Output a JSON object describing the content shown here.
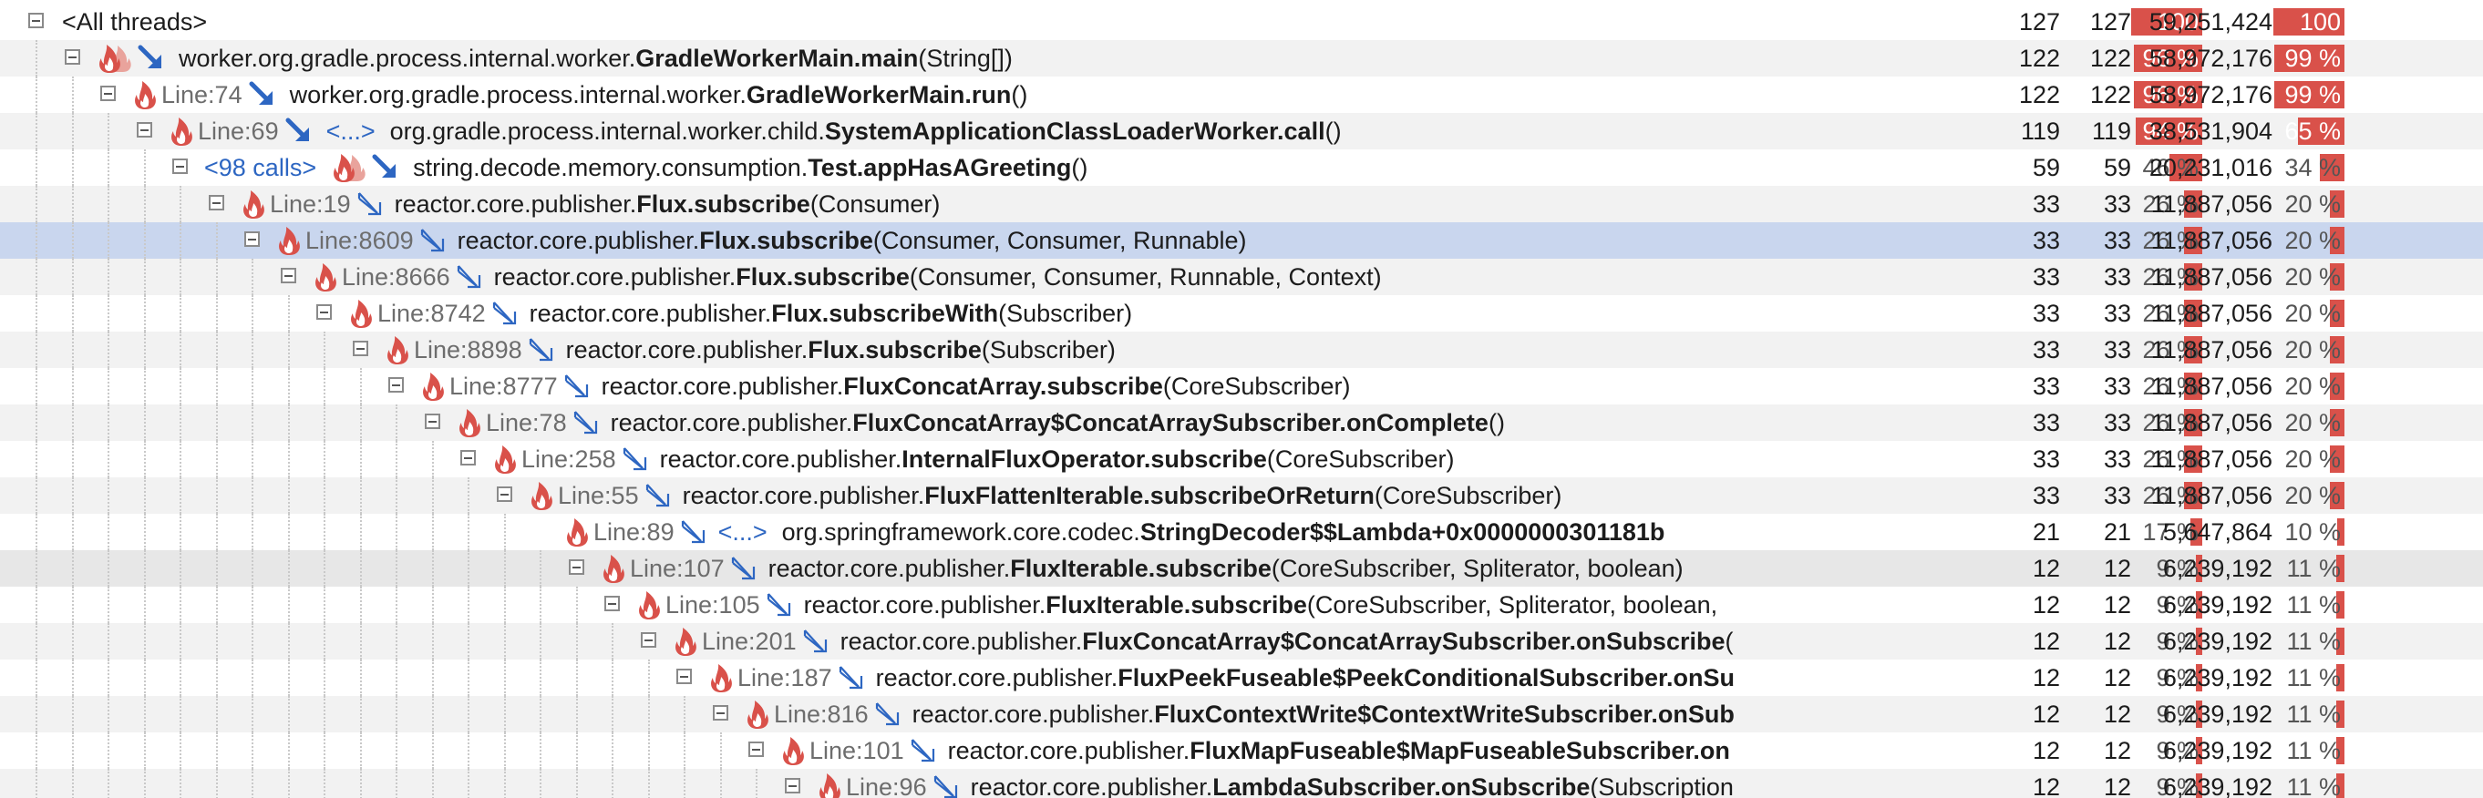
{
  "colors": {
    "accent_red": "#d9514a",
    "selection": "#c9d6ee",
    "call_blue": "#2d66c2",
    "line_gray": "#6d6d6d"
  },
  "icons": [
    "flame-icon",
    "hot-spot-arrow-icon",
    "call-arrow-icon",
    "collapse-icon"
  ],
  "tree": {
    "root": {
      "label": "<All threads>",
      "time_count": "127",
      "invocations": "127",
      "time_pct": "100 %",
      "time_pct_value": 100,
      "bytes": "59,251,424",
      "bytes_pct": "100 %",
      "bytes_pct_value": 100
    },
    "rows": [
      {
        "line": "",
        "calls": "",
        "dots": "",
        "method_prefix": "worker.org.gradle.process.internal.worker.",
        "method_bold": "GradleWorkerMain.main",
        "params": "(String[])",
        "time_count": "122",
        "invocations": "122",
        "time_pct": "96 %",
        "time_pct_value": 96,
        "bytes": "58,972,176",
        "bytes_pct": "99 %",
        "bytes_pct_value": 99
      },
      {
        "line": "Line:74",
        "calls": "",
        "dots": "",
        "method_prefix": "worker.org.gradle.process.internal.worker.",
        "method_bold": "GradleWorkerMain.run",
        "params": "()",
        "time_count": "122",
        "invocations": "122",
        "time_pct": "96 %",
        "time_pct_value": 96,
        "bytes": "58,972,176",
        "bytes_pct": "99 %",
        "bytes_pct_value": 99
      },
      {
        "line": "Line:69",
        "calls": "",
        "dots": "<...>",
        "method_prefix": "org.gradle.process.internal.worker.child.",
        "method_bold": "SystemApplicationClassLoaderWorker.call",
        "params": "()",
        "time_count": "119",
        "invocations": "119",
        "time_pct": "94 %",
        "time_pct_value": 94,
        "bytes": "38,531,904",
        "bytes_pct": "65 %",
        "bytes_pct_value": 65
      },
      {
        "line": "",
        "calls": "<98 calls>",
        "dots": "",
        "method_prefix": "string.decode.memory.consumption.",
        "method_bold": "Test.appHasAGreeting",
        "params": "()",
        "time_count": "59",
        "invocations": "59",
        "time_pct": "46 %",
        "time_pct_value": 46,
        "bytes": "20,231,016",
        "bytes_pct": "34 %",
        "bytes_pct_value": 34
      },
      {
        "line": "Line:19",
        "calls": "",
        "dots": "",
        "method_prefix": "reactor.core.publisher.",
        "method_bold": "Flux.subscribe",
        "params": "(Consumer)",
        "time_count": "33",
        "invocations": "33",
        "time_pct": "26 %",
        "time_pct_value": 26,
        "bytes": "11,887,056",
        "bytes_pct": "20 %",
        "bytes_pct_value": 20
      },
      {
        "line": "Line:8609",
        "calls": "",
        "dots": "",
        "method_prefix": "reactor.core.publisher.",
        "method_bold": "Flux.subscribe",
        "params": "(Consumer, Consumer, Runnable)",
        "time_count": "33",
        "invocations": "33",
        "time_pct": "26 %",
        "time_pct_value": 26,
        "bytes": "11,887,056",
        "bytes_pct": "20 %",
        "bytes_pct_value": 20
      },
      {
        "line": "Line:8666",
        "calls": "",
        "dots": "",
        "method_prefix": "reactor.core.publisher.",
        "method_bold": "Flux.subscribe",
        "params": "(Consumer, Consumer, Runnable, Context)",
        "time_count": "33",
        "invocations": "33",
        "time_pct": "26 %",
        "time_pct_value": 26,
        "bytes": "11,887,056",
        "bytes_pct": "20 %",
        "bytes_pct_value": 20
      },
      {
        "line": "Line:8742",
        "calls": "",
        "dots": "",
        "method_prefix": "reactor.core.publisher.",
        "method_bold": "Flux.subscribeWith",
        "params": "(Subscriber)",
        "time_count": "33",
        "invocations": "33",
        "time_pct": "26 %",
        "time_pct_value": 26,
        "bytes": "11,887,056",
        "bytes_pct": "20 %",
        "bytes_pct_value": 20
      },
      {
        "line": "Line:8898",
        "calls": "",
        "dots": "",
        "method_prefix": "reactor.core.publisher.",
        "method_bold": "Flux.subscribe",
        "params": "(Subscriber)",
        "time_count": "33",
        "invocations": "33",
        "time_pct": "26 %",
        "time_pct_value": 26,
        "bytes": "11,887,056",
        "bytes_pct": "20 %",
        "bytes_pct_value": 20
      },
      {
        "line": "Line:8777",
        "calls": "",
        "dots": "",
        "method_prefix": "reactor.core.publisher.",
        "method_bold": "FluxConcatArray.subscribe",
        "params": "(CoreSubscriber)",
        "time_count": "33",
        "invocations": "33",
        "time_pct": "26 %",
        "time_pct_value": 26,
        "bytes": "11,887,056",
        "bytes_pct": "20 %",
        "bytes_pct_value": 20
      },
      {
        "line": "Line:78",
        "calls": "",
        "dots": "",
        "method_prefix": "reactor.core.publisher.",
        "method_bold": "FluxConcatArray$ConcatArraySubscriber.onComplete",
        "params": "()",
        "time_count": "33",
        "invocations": "33",
        "time_pct": "26 %",
        "time_pct_value": 26,
        "bytes": "11,887,056",
        "bytes_pct": "20 %",
        "bytes_pct_value": 20
      },
      {
        "line": "Line:258",
        "calls": "",
        "dots": "",
        "method_prefix": "reactor.core.publisher.",
        "method_bold": "InternalFluxOperator.subscribe",
        "params": "(CoreSubscriber)",
        "time_count": "33",
        "invocations": "33",
        "time_pct": "26 %",
        "time_pct_value": 26,
        "bytes": "11,887,056",
        "bytes_pct": "20 %",
        "bytes_pct_value": 20
      },
      {
        "line": "Line:55",
        "calls": "",
        "dots": "",
        "method_prefix": "reactor.core.publisher.",
        "method_bold": "FluxFlattenIterable.subscribeOrReturn",
        "params": "(CoreSubscriber)",
        "time_count": "33",
        "invocations": "33",
        "time_pct": "26 %",
        "time_pct_value": 26,
        "bytes": "11,887,056",
        "bytes_pct": "20 %",
        "bytes_pct_value": 20
      },
      {
        "line": "Line:89",
        "calls": "",
        "dots": "<...>",
        "method_prefix": "org.springframework.core.codec.",
        "method_bold": "StringDecoder$$Lambda+0x0000000301181b",
        "params": "",
        "time_count": "21",
        "invocations": "21",
        "time_pct": "17 %",
        "time_pct_value": 17,
        "bytes": "5,647,864",
        "bytes_pct": "10 %",
        "bytes_pct_value": 10
      },
      {
        "line": "Line:107",
        "calls": "",
        "dots": "",
        "method_prefix": "reactor.core.publisher.",
        "method_bold": "FluxIterable.subscribe",
        "params": "(CoreSubscriber, Spliterator, boolean)",
        "time_count": "12",
        "invocations": "12",
        "time_pct": "9 %",
        "time_pct_value": 9,
        "bytes": "6,239,192",
        "bytes_pct": "11 %",
        "bytes_pct_value": 11
      },
      {
        "line": "Line:105",
        "calls": "",
        "dots": "",
        "method_prefix": "reactor.core.publisher.",
        "method_bold": "FluxIterable.subscribe",
        "params": "(CoreSubscriber, Spliterator, boolean,",
        "time_count": "12",
        "invocations": "12",
        "time_pct": "9 %",
        "time_pct_value": 9,
        "bytes": "6,239,192",
        "bytes_pct": "11 %",
        "bytes_pct_value": 11
      },
      {
        "line": "Line:201",
        "calls": "",
        "dots": "",
        "method_prefix": "reactor.core.publisher.",
        "method_bold": "FluxConcatArray$ConcatArraySubscriber.onSubscribe",
        "params": "(",
        "time_count": "12",
        "invocations": "12",
        "time_pct": "9 %",
        "time_pct_value": 9,
        "bytes": "6,239,192",
        "bytes_pct": "11 %",
        "bytes_pct_value": 11
      },
      {
        "line": "Line:187",
        "calls": "",
        "dots": "",
        "method_prefix": "reactor.core.publisher.",
        "method_bold": "FluxPeekFuseable$PeekConditionalSubscriber.onSu",
        "params": "",
        "time_count": "12",
        "invocations": "12",
        "time_pct": "9 %",
        "time_pct_value": 9,
        "bytes": "6,239,192",
        "bytes_pct": "11 %",
        "bytes_pct_value": 11
      },
      {
        "line": "Line:816",
        "calls": "",
        "dots": "",
        "method_prefix": "reactor.core.publisher.",
        "method_bold": "FluxContextWrite$ContextWriteSubscriber.onSub",
        "params": "",
        "time_count": "12",
        "invocations": "12",
        "time_pct": "9 %",
        "time_pct_value": 9,
        "bytes": "6,239,192",
        "bytes_pct": "11 %",
        "bytes_pct_value": 11
      },
      {
        "line": "Line:101",
        "calls": "",
        "dots": "",
        "method_prefix": "reactor.core.publisher.",
        "method_bold": "FluxMapFuseable$MapFuseableSubscriber.on",
        "params": "",
        "time_count": "12",
        "invocations": "12",
        "time_pct": "9 %",
        "time_pct_value": 9,
        "bytes": "6,239,192",
        "bytes_pct": "11 %",
        "bytes_pct_value": 11
      },
      {
        "line": "Line:96",
        "calls": "",
        "dots": "",
        "method_prefix": "reactor.core.publisher.",
        "method_bold": "LambdaSubscriber.onSubscribe",
        "params": "(Subscription",
        "time_count": "12",
        "invocations": "12",
        "time_pct": "9 %",
        "time_pct_value": 9,
        "bytes": "6,239,192",
        "bytes_pct": "11 %",
        "bytes_pct_value": 11
      }
    ]
  }
}
